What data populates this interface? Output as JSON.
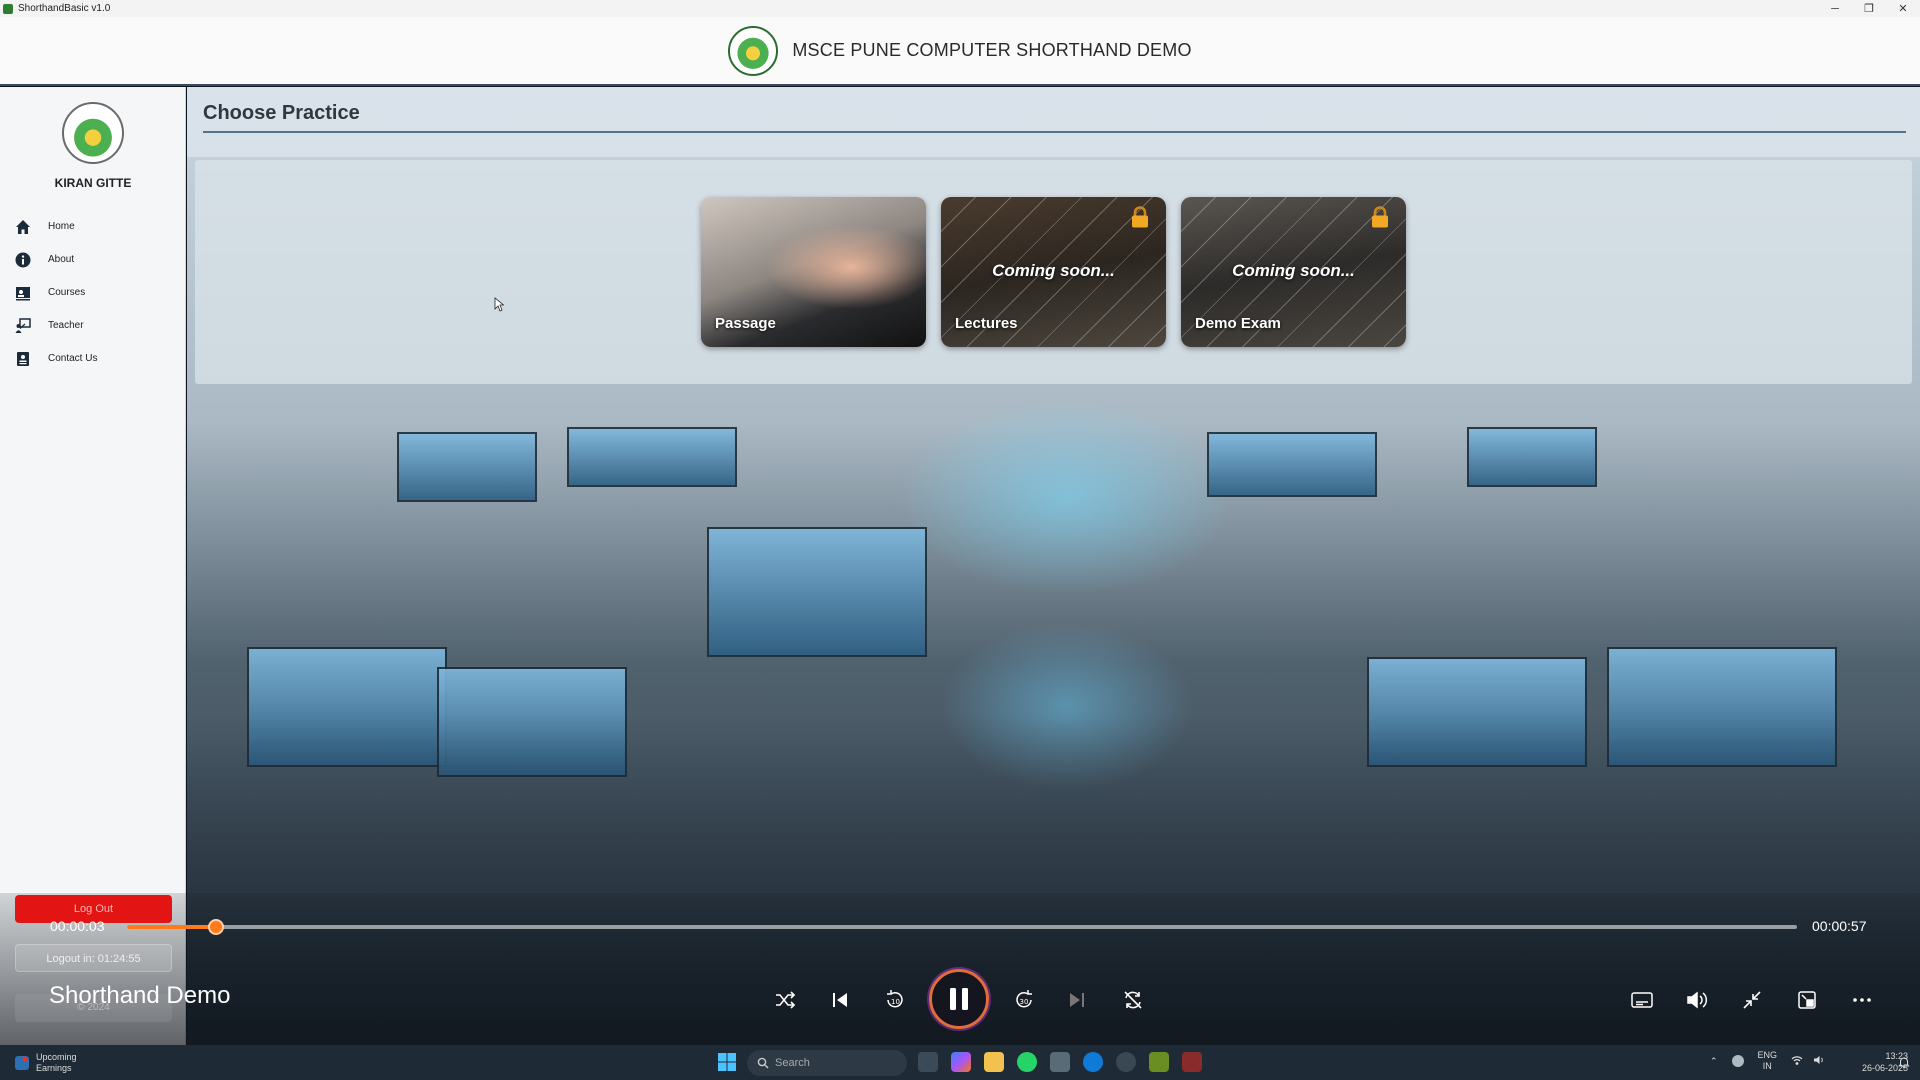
{
  "window": {
    "title": "ShorthandBasic v1.0",
    "controls": {
      "minimize": "─",
      "restore": "❐",
      "close": "✕"
    }
  },
  "header": {
    "title": "MSCE PUNE COMPUTER SHORTHAND DEMO"
  },
  "sidebar": {
    "username": "KIRAN GITTE",
    "items": [
      {
        "label": "Home",
        "icon": "home-icon"
      },
      {
        "label": "About",
        "icon": "info-icon"
      },
      {
        "label": "Courses",
        "icon": "courses-icon"
      },
      {
        "label": "Teacher",
        "icon": "teacher-icon"
      },
      {
        "label": "Contact Us",
        "icon": "contact-icon"
      }
    ],
    "logout_label": "Log Out",
    "logout_in": "Logout in: 01:24:55",
    "copyright": "© 2024"
  },
  "practice": {
    "heading": "Choose Practice",
    "cards": [
      {
        "name": "Passage",
        "status": "",
        "locked": false
      },
      {
        "name": "Lectures",
        "status": "Coming soon...",
        "locked": true
      },
      {
        "name": "Demo Exam",
        "status": "Coming soon...",
        "locked": true
      }
    ]
  },
  "player": {
    "title": "Shorthand Demo",
    "elapsed": "00:00:03",
    "duration": "00:00:57",
    "progress": 0.053,
    "state": "playing",
    "accent": "#ff7a1a"
  },
  "taskbar": {
    "weather_line1": "Upcoming",
    "weather_line2": "Earnings",
    "search_placeholder": "Search",
    "lang_line1": "ENG",
    "lang_line2": "IN",
    "time": "13:23",
    "date": "26-06-2025"
  }
}
